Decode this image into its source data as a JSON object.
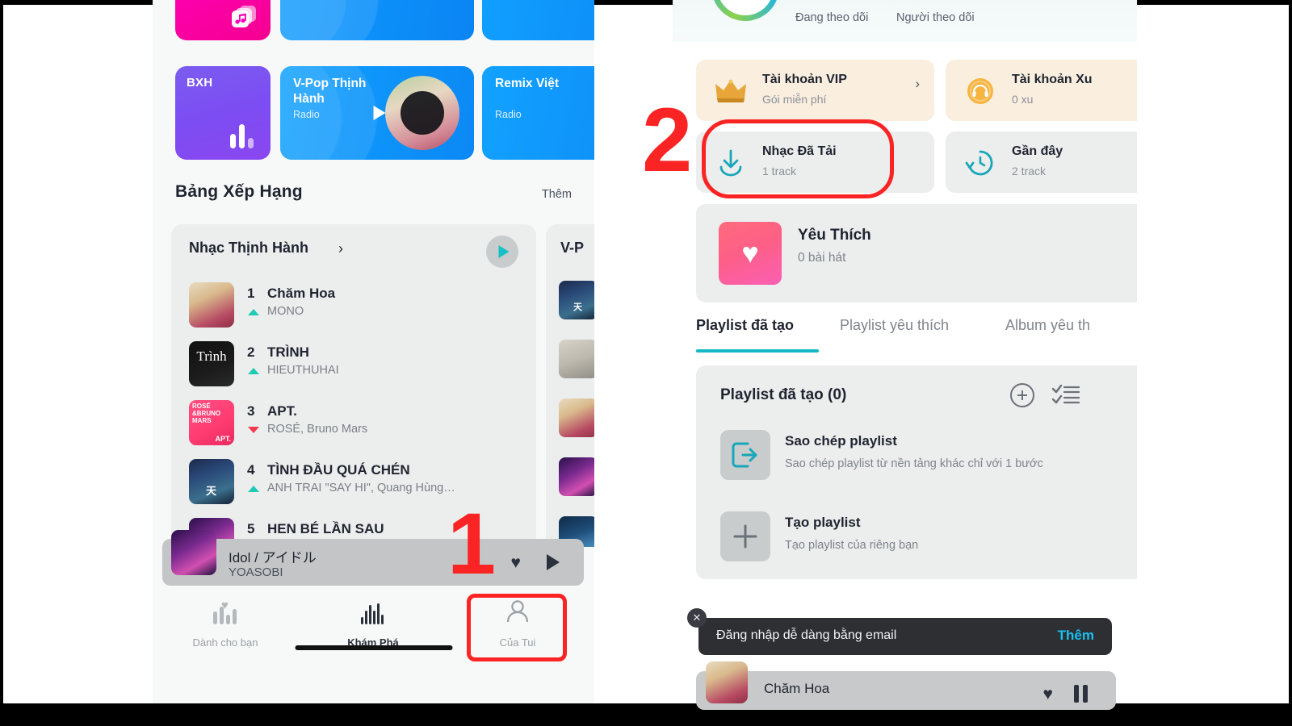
{
  "left_phone": {
    "tiles_row1": [
      {
        "name": "pink-music-tile",
        "label": ""
      },
      {
        "name": "blue-tile-a",
        "label": ""
      },
      {
        "name": "blue-tile-b",
        "label": ""
      }
    ],
    "tiles_row2": [
      {
        "label": "BXH",
        "sub": ""
      },
      {
        "label": "V-Pop Thịnh Hành",
        "sub": "Radio"
      },
      {
        "label": "Remix Việt",
        "sub": "Radio"
      }
    ],
    "section": {
      "title": "Bảng Xếp Hạng",
      "more": "Thêm"
    },
    "chart_card": {
      "title": "Nhạc Thịnh Hành",
      "chevron": "›",
      "rows": [
        {
          "rank": "1",
          "title": "Chăm Hoa",
          "artist": "MONO",
          "trend": "up"
        },
        {
          "rank": "2",
          "title": "TRÌNH",
          "artist": "HIEUTHUHAI",
          "trend": "up"
        },
        {
          "rank": "3",
          "title": "APT.",
          "artist": "ROSÉ, Bruno Mars",
          "trend": "down"
        },
        {
          "rank": "4",
          "title": "TÌNH ĐẦU QUÁ CHÉN",
          "artist": "ANH TRAI \"SAY HI\", Quang Hùng…",
          "trend": "up"
        },
        {
          "rank": "5",
          "title": "HEN BÉ LẦN SAU",
          "artist": "",
          "trend": "up"
        }
      ]
    },
    "chart_card_next": {
      "title": "V-P"
    },
    "mini_player": {
      "title": "Idol / アイドル",
      "artist": "YOASOBI",
      "heart_icon": "heart-icon",
      "play_icon": "play-icon"
    },
    "tabbar": [
      {
        "label": "Dành cho bạn",
        "icon": "chart-heart-icon",
        "active": false
      },
      {
        "label": "Khám Phá",
        "icon": "waveform-icon",
        "active": true
      },
      {
        "label": "Của Tui",
        "icon": "person-icon",
        "active": false
      }
    ]
  },
  "right_phone": {
    "profile": {
      "following_label": "Đang theo dõi",
      "followers_label": "Người theo dõi"
    },
    "account_cards": [
      {
        "title": "Tài khoản VIP",
        "sub": "Gói miễn phí",
        "icon": "crown-icon",
        "chevron": "›"
      },
      {
        "title": "Tài khoản Xu",
        "sub": "0 xu",
        "icon": "coin-icon",
        "chevron": "›"
      },
      {
        "title": "Nhạc Đã Tải",
        "sub": "1 track",
        "icon": "download-icon",
        "chevron": ""
      },
      {
        "title": "Gần đây",
        "sub": "2 track",
        "icon": "history-clock-icon",
        "chevron": ""
      }
    ],
    "favorite": {
      "title": "Yêu Thích",
      "sub": "0 bài hát",
      "icon": "heart-icon"
    },
    "tabs": [
      {
        "label": "Playlist đã tạo",
        "active": true
      },
      {
        "label": "Playlist yêu thích",
        "active": false
      },
      {
        "label": "Album yêu th",
        "active": false
      }
    ],
    "playlist_panel": {
      "heading": "Playlist đã tạo (0)",
      "add_icon": "plus-circle-icon",
      "list_icon": "checklist-icon",
      "items": [
        {
          "title": "Sao chép playlist",
          "sub": "Sao chép playlist từ nền tảng khác chỉ với 1 bước",
          "icon": "import-arrow-icon"
        },
        {
          "title": "Tạo playlist",
          "sub": "Tạo playlist của riêng bạn",
          "icon": "plus-icon"
        }
      ]
    },
    "toast": {
      "text": "Đăng nhập dễ dàng bằng email",
      "cta": "Thêm",
      "close_icon": "close-icon"
    },
    "player": {
      "title": "Chăm Hoa",
      "heart_icon": "heart-icon",
      "pause_icon": "pause-icon"
    }
  },
  "annotations": {
    "step1": "1",
    "step2": "2",
    "highlight_color": "#fb2424"
  }
}
